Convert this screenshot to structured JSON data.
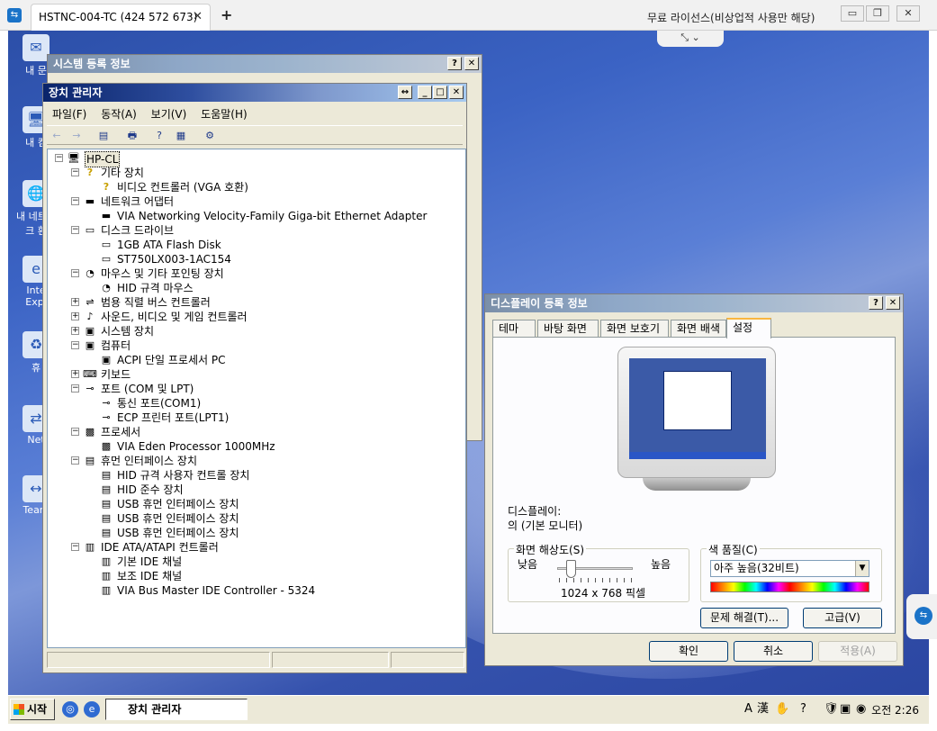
{
  "remote": {
    "tab_title": "HSTNC-004-TC (424 572 673)",
    "tab_close": "✕",
    "new_tab": "+",
    "license_notice": "무료 라이선스(비상업적 사용만 해당)",
    "controls": {
      "minimize": "▭",
      "restore": "❐",
      "close": "✕"
    },
    "toolbar_toggle": "⤡ ⌄"
  },
  "desktop": {
    "icons": [
      {
        "label": "내 문",
        "glyph": "✉"
      },
      {
        "label": "내 컴",
        "glyph": "🖥"
      },
      {
        "label": "내 네트워크 환",
        "glyph": "🌐"
      },
      {
        "label": "Inte Expl",
        "glyph": "e"
      },
      {
        "label": "휴",
        "glyph": "♻"
      },
      {
        "label": "Net",
        "glyph": "⇄"
      },
      {
        "label": "Team",
        "glyph": "↔"
      }
    ]
  },
  "system_props": {
    "title": "시스템 등록 정보",
    "help": "?",
    "close": "✕"
  },
  "device_manager": {
    "title": "장치 관리자",
    "title_btns": {
      "resize": "↔",
      "minimize": "_",
      "maximize": "□",
      "close": "✕"
    },
    "menu": [
      "파일(F)",
      "동작(A)",
      "보기(V)",
      "도움말(H)"
    ],
    "toolbar": [
      "←",
      "→",
      "▤",
      "🖶",
      "?",
      "▦",
      "⚙"
    ],
    "tree": [
      {
        "level": 0,
        "exp": "−",
        "icon": "🖥",
        "label": "HP-CL",
        "selected": true
      },
      {
        "level": 1,
        "exp": "−",
        "icon": "?",
        "label": "기타 장치"
      },
      {
        "level": 2,
        "exp": "",
        "icon": "?",
        "label": "비디오 컨트롤러 (VGA 호환)"
      },
      {
        "level": 1,
        "exp": "−",
        "icon": "▬",
        "label": "네트워크 어댑터"
      },
      {
        "level": 2,
        "exp": "",
        "icon": "▬",
        "label": "VIA Networking Velocity-Family Giga-bit Ethernet Adapter"
      },
      {
        "level": 1,
        "exp": "−",
        "icon": "▭",
        "label": "디스크 드라이브"
      },
      {
        "level": 2,
        "exp": "",
        "icon": "▭",
        "label": "1GB ATA Flash Disk"
      },
      {
        "level": 2,
        "exp": "",
        "icon": "▭",
        "label": "ST750LX003-1AC154"
      },
      {
        "level": 1,
        "exp": "−",
        "icon": "◔",
        "label": "마우스 및 기타 포인팅 장치"
      },
      {
        "level": 2,
        "exp": "",
        "icon": "◔",
        "label": "HID 규격 마우스"
      },
      {
        "level": 1,
        "exp": "+",
        "icon": "⇌",
        "label": "범용 직렬 버스 컨트롤러"
      },
      {
        "level": 1,
        "exp": "+",
        "icon": "♪",
        "label": "사운드, 비디오 및 게임 컨트롤러"
      },
      {
        "level": 1,
        "exp": "+",
        "icon": "▣",
        "label": "시스템 장치"
      },
      {
        "level": 1,
        "exp": "−",
        "icon": "▣",
        "label": "컴퓨터"
      },
      {
        "level": 2,
        "exp": "",
        "icon": "▣",
        "label": "ACPI 단일 프로세서 PC"
      },
      {
        "level": 1,
        "exp": "+",
        "icon": "⌨",
        "label": "키보드"
      },
      {
        "level": 1,
        "exp": "−",
        "icon": "⊸",
        "label": "포트 (COM 및 LPT)"
      },
      {
        "level": 2,
        "exp": "",
        "icon": "⊸",
        "label": "통신 포트(COM1)"
      },
      {
        "level": 2,
        "exp": "",
        "icon": "⊸",
        "label": "ECP 프린터 포트(LPT1)"
      },
      {
        "level": 1,
        "exp": "−",
        "icon": "▩",
        "label": "프로세서"
      },
      {
        "level": 2,
        "exp": "",
        "icon": "▩",
        "label": "VIA Eden Processor 1000MHz"
      },
      {
        "level": 1,
        "exp": "−",
        "icon": "▤",
        "label": "휴먼 인터페이스 장치"
      },
      {
        "level": 2,
        "exp": "",
        "icon": "▤",
        "label": "HID 규격 사용자 컨트롤 장치"
      },
      {
        "level": 2,
        "exp": "",
        "icon": "▤",
        "label": "HID 준수 장치"
      },
      {
        "level": 2,
        "exp": "",
        "icon": "▤",
        "label": "USB 휴먼 인터페이스 장치"
      },
      {
        "level": 2,
        "exp": "",
        "icon": "▤",
        "label": "USB 휴먼 인터페이스 장치"
      },
      {
        "level": 2,
        "exp": "",
        "icon": "▤",
        "label": "USB 휴먼 인터페이스 장치"
      },
      {
        "level": 1,
        "exp": "−",
        "icon": "▥",
        "label": "IDE ATA/ATAPI 컨트롤러"
      },
      {
        "level": 2,
        "exp": "",
        "icon": "▥",
        "label": "기본 IDE 채널"
      },
      {
        "level": 2,
        "exp": "",
        "icon": "▥",
        "label": "보조 IDE 채널"
      },
      {
        "level": 2,
        "exp": "",
        "icon": "▥",
        "label": "VIA Bus Master IDE Controller - 5324"
      }
    ]
  },
  "display_props": {
    "title": "디스플레이 등록 정보",
    "help": "?",
    "close": "✕",
    "tabs": [
      "테마",
      "바탕 화면",
      "화면 보호기",
      "화면 배색",
      "설정"
    ],
    "active_tab": 4,
    "display_label": "디스플레이:",
    "display_value": "의 (기본 모니터)",
    "resolution": {
      "legend": "화면 해상도(S)",
      "low": "낮음",
      "high": "높음",
      "value": "1024 x 768 픽셀",
      "slider_fraction": 0.18
    },
    "color_quality": {
      "legend": "색 품질(C)",
      "selected": "아주 높음(32비트)",
      "arrow": "▼"
    },
    "troubleshoot_btn": "문제 해결(T)...",
    "advanced_btn": "고급(V)",
    "ok_btn": "확인",
    "cancel_btn": "취소",
    "apply_btn": "적용(A)"
  },
  "taskbar": {
    "start": "시작",
    "quick_launch": [
      "◎",
      "e"
    ],
    "active_task": "장치 관리자",
    "tray": [
      "A",
      "漢",
      "✋",
      "?",
      "🛡",
      "▣",
      "◉"
    ],
    "clock": "오전 2:26"
  },
  "colors": {
    "xp_face": "#ece9d8",
    "title_active": "#0a246a",
    "desktop_blue": "#3b63c4"
  }
}
